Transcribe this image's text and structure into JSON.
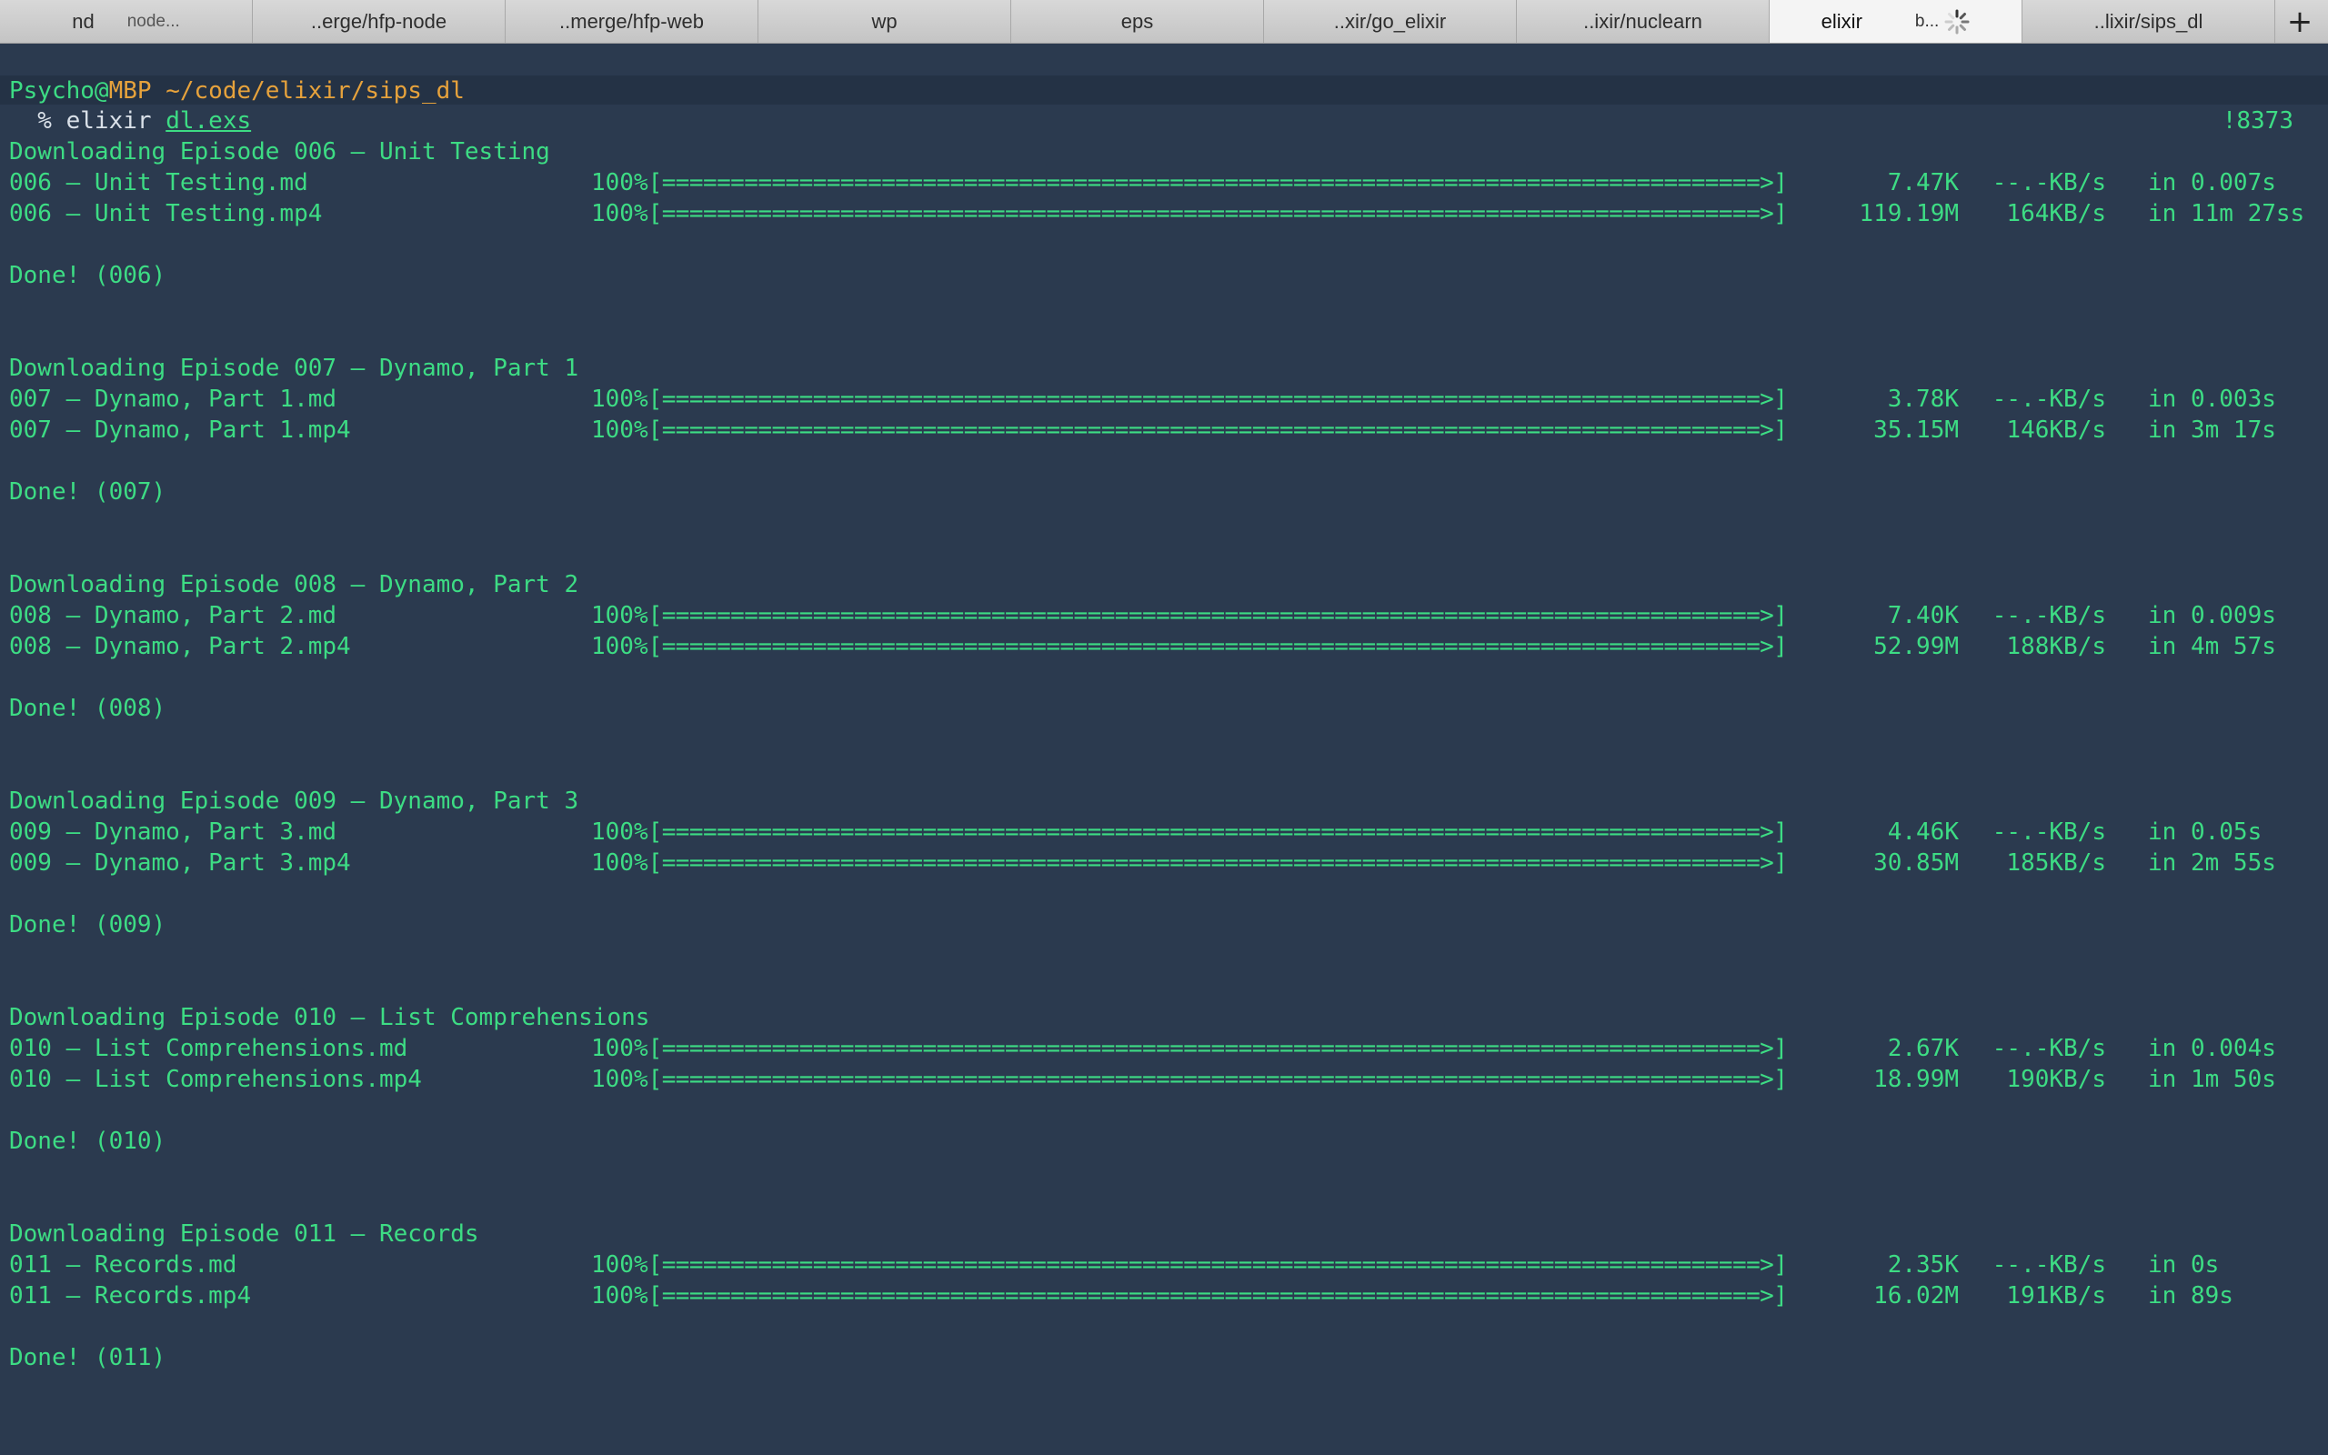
{
  "tabs": [
    {
      "label": "nd",
      "sub": "node...",
      "active": false
    },
    {
      "label": "..erge/hfp-node",
      "sub": "",
      "active": false
    },
    {
      "label": "..merge/hfp-web",
      "sub": "",
      "active": false
    },
    {
      "label": "wp",
      "sub": "",
      "active": false
    },
    {
      "label": "eps",
      "sub": "",
      "active": false
    },
    {
      "label": "..xir/go_elixir",
      "sub": "",
      "active": false
    },
    {
      "label": "..ixir/nuclearn",
      "sub": "",
      "active": false
    },
    {
      "label": "elixir",
      "sub": "b...",
      "active": true
    },
    {
      "label": "..lixir/sips_dl",
      "sub": "",
      "active": false
    }
  ],
  "new_tab_label": "+",
  "prompt": {
    "user": "Psycho",
    "at": "@",
    "host": "MBP",
    "path": "~/code/elixir/sips_dl",
    "symbol": "  % ",
    "command": "elixir ",
    "script": "dl.exs",
    "history": "!8373"
  },
  "episodes": [
    {
      "heading": "Downloading Episode 006 – Unit Testing",
      "files": [
        {
          "name": "006 – Unit Testing.md",
          "pct": "100%",
          "bar": "[================================================================================>]",
          "size": "7.47K",
          "rate": "--.-KB/s",
          "time": "in 0.007s"
        },
        {
          "name": "006 – Unit Testing.mp4",
          "pct": "100%",
          "bar": "[================================================================================>]",
          "size": "119.19M",
          "rate": "164KB/s",
          "time": "in 11m 27ss"
        }
      ],
      "done": "Done! (006)"
    },
    {
      "heading": "Downloading Episode 007 – Dynamo, Part 1",
      "files": [
        {
          "name": "007 – Dynamo, Part 1.md",
          "pct": "100%",
          "bar": "[================================================================================>]",
          "size": "3.78K",
          "rate": "--.-KB/s",
          "time": "in 0.003s"
        },
        {
          "name": "007 – Dynamo, Part 1.mp4",
          "pct": "100%",
          "bar": "[================================================================================>]",
          "size": "35.15M",
          "rate": "146KB/s",
          "time": "in 3m 17s"
        }
      ],
      "done": "Done! (007)"
    },
    {
      "heading": "Downloading Episode 008 – Dynamo, Part 2",
      "files": [
        {
          "name": "008 – Dynamo, Part 2.md",
          "pct": "100%",
          "bar": "[================================================================================>]",
          "size": "7.40K",
          "rate": "--.-KB/s",
          "time": "in 0.009s"
        },
        {
          "name": "008 – Dynamo, Part 2.mp4",
          "pct": "100%",
          "bar": "[================================================================================>]",
          "size": "52.99M",
          "rate": "188KB/s",
          "time": "in 4m 57s"
        }
      ],
      "done": "Done! (008)"
    },
    {
      "heading": "Downloading Episode 009 – Dynamo, Part 3",
      "files": [
        {
          "name": "009 – Dynamo, Part 3.md",
          "pct": "100%",
          "bar": "[================================================================================>]",
          "size": "4.46K",
          "rate": "--.-KB/s",
          "time": "in 0.05s"
        },
        {
          "name": "009 – Dynamo, Part 3.mp4",
          "pct": "100%",
          "bar": "[================================================================================>]",
          "size": "30.85M",
          "rate": "185KB/s",
          "time": "in 2m 55s"
        }
      ],
      "done": "Done! (009)"
    },
    {
      "heading": "Downloading Episode 010 – List Comprehensions",
      "files": [
        {
          "name": "010 – List Comprehensions.md",
          "pct": "100%",
          "bar": "[================================================================================>]",
          "size": "2.67K",
          "rate": "--.-KB/s",
          "time": "in 0.004s"
        },
        {
          "name": "010 – List Comprehensions.mp4",
          "pct": "100%",
          "bar": "[================================================================================>]",
          "size": "18.99M",
          "rate": "190KB/s",
          "time": "in 1m 50s"
        }
      ],
      "done": "Done! (010)"
    },
    {
      "heading": "Downloading Episode 011 – Records",
      "files": [
        {
          "name": "011 – Records.md",
          "pct": "100%",
          "bar": "[================================================================================>]",
          "size": "2.35K",
          "rate": "--.-KB/s",
          "time": "in 0s"
        },
        {
          "name": "011 – Records.mp4",
          "pct": "100%",
          "bar": "[================================================================================>]",
          "size": "16.02M",
          "rate": "191KB/s",
          "time": "in 89s"
        }
      ],
      "done": "Done! (011)"
    }
  ],
  "colors": {
    "background": "#2b3a4f",
    "output_text": "#3ddc84",
    "path_text": "#e6a23c",
    "tabbar": "#cfcfcf"
  }
}
